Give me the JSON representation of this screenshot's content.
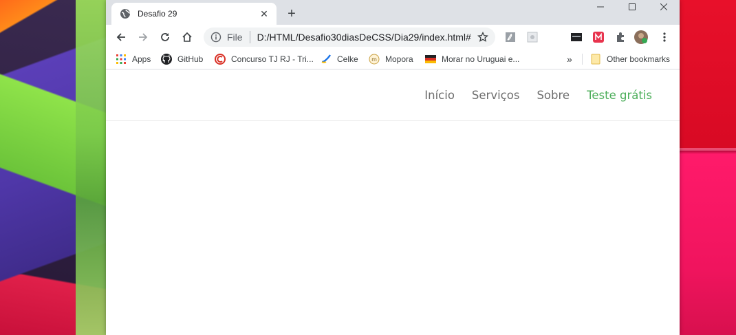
{
  "tab": {
    "title": "Desafio 29",
    "close": "✕"
  },
  "newtab": "+",
  "window_controls": {
    "minimize": "—",
    "maximize": "☐",
    "close": "✕"
  },
  "omnibox": {
    "scheme": "File",
    "url": "D:/HTML/Desafio30diasDeCSS/Dia29/index.html#"
  },
  "bookmarks": {
    "items": [
      {
        "label": "Apps",
        "icon": "apps-grid-icon"
      },
      {
        "label": "GitHub",
        "icon": "github-icon"
      },
      {
        "label": "Concurso TJ RJ - Tri...",
        "icon": "concurso-icon"
      },
      {
        "label": "Celke",
        "icon": "celke-icon"
      },
      {
        "label": "Mopora",
        "icon": "mopora-icon"
      },
      {
        "label": "Morar no Uruguai e...",
        "icon": "flag-icon"
      }
    ],
    "overflow": "»",
    "other": "Other bookmarks"
  },
  "nav": {
    "links": [
      "Início",
      "Serviços",
      "Sobre"
    ],
    "cta": "Teste grátis"
  },
  "colors": {
    "nav_link": "#6d6d6d",
    "cta": "#4cae5a",
    "tabstrip": "#dee1e6"
  }
}
